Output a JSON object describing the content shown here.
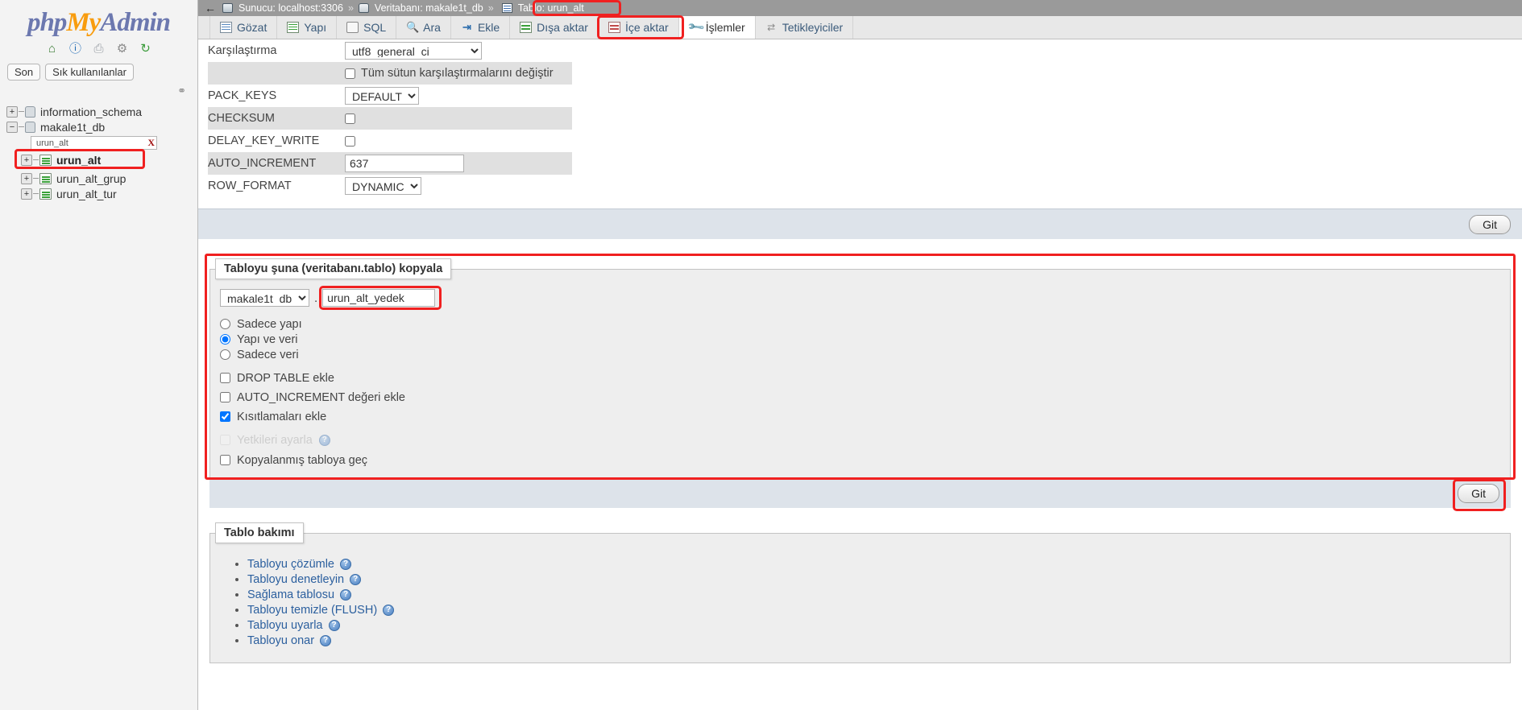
{
  "sidebar": {
    "logo": {
      "part1": "php",
      "part2": "My",
      "part3": "Admin"
    },
    "icons": [
      {
        "name": "home-icon",
        "glyph": "⌂"
      },
      {
        "name": "help-icon",
        "glyph": "?"
      },
      {
        "name": "documentation-icon",
        "glyph": "❐"
      },
      {
        "name": "settings-gear-icon",
        "glyph": "⚙"
      },
      {
        "name": "reload-icon",
        "glyph": "↻"
      }
    ],
    "pills": [
      {
        "label": "Son"
      },
      {
        "label": "Sık kullanılanlar"
      }
    ],
    "chain_icon": "⚭",
    "tree": [
      {
        "label": "information_schema",
        "type": "db",
        "expander": "+"
      },
      {
        "label": "makale1t_db",
        "type": "db",
        "expander": "−"
      }
    ],
    "filter": {
      "value": "urun_alt",
      "clear_label": "X"
    },
    "tables": [
      {
        "label": "urun_alt",
        "expander": "+",
        "selected": true
      },
      {
        "label": "urun_alt_grup",
        "expander": "+",
        "selected": false
      },
      {
        "label": "urun_alt_tur",
        "expander": "+",
        "selected": false
      }
    ]
  },
  "breadcrumb": {
    "back_arrow": "←",
    "server": "Sunucu: localhost:3306",
    "database": "Veritabanı: makale1t_db",
    "table": "Tablo: urun_alt",
    "sep": "»"
  },
  "tabs": [
    {
      "label": "Gözat",
      "icon": "browse-icon",
      "active": false
    },
    {
      "label": "Yapı",
      "icon": "structure-icon",
      "active": false
    },
    {
      "label": "SQL",
      "icon": "sql-icon",
      "active": false
    },
    {
      "label": "Ara",
      "icon": "search-icon",
      "active": false
    },
    {
      "label": "Ekle",
      "icon": "insert-icon",
      "active": false
    },
    {
      "label": "Dışa aktar",
      "icon": "export-icon",
      "active": false
    },
    {
      "label": "İçe aktar",
      "icon": "import-icon",
      "active": false
    },
    {
      "label": "İşlemler",
      "icon": "operations-wrench-icon",
      "active": true
    },
    {
      "label": "Tetikleyiciler",
      "icon": "triggers-icon",
      "active": false
    }
  ],
  "table_options": {
    "rows": [
      {
        "label": "Karşılaştırma",
        "control": "select",
        "value": "utf8_general_ci"
      },
      {
        "label": "",
        "control": "checkbox",
        "value": "Tüm sütun karşılaştırmalarını değiştir",
        "checked": false
      },
      {
        "label": "PACK_KEYS",
        "control": "select",
        "value": "DEFAULT"
      },
      {
        "label": "CHECKSUM",
        "control": "checkbox",
        "value": "",
        "checked": false
      },
      {
        "label": "DELAY_KEY_WRITE",
        "control": "checkbox",
        "value": "",
        "checked": false
      },
      {
        "label": "AUTO_INCREMENT",
        "control": "text",
        "value": "637"
      },
      {
        "label": "ROW_FORMAT",
        "control": "select",
        "value": "DYNAMIC"
      }
    ],
    "submit_label": "Git"
  },
  "copy_table": {
    "legend": "Tabloyu şuna (veritabanı.tablo) kopyala",
    "db_select": "makale1t_db",
    "dot": ".",
    "table_name": "urun_alt_yedek",
    "radios": [
      {
        "label": "Sadece yapı",
        "checked": false
      },
      {
        "label": "Yapı ve veri",
        "checked": true
      },
      {
        "label": "Sadece veri",
        "checked": false
      }
    ],
    "checkboxes": [
      {
        "label": "DROP TABLE ekle",
        "checked": false,
        "disabled": false,
        "help": false
      },
      {
        "label": "AUTO_INCREMENT değeri ekle",
        "checked": false,
        "disabled": false,
        "help": false
      },
      {
        "label": "Kısıtlamaları ekle",
        "checked": true,
        "disabled": false,
        "help": false
      }
    ],
    "checkboxes2": [
      {
        "label": "Yetkileri ayarla",
        "checked": false,
        "disabled": true,
        "help": true
      },
      {
        "label": "Kopyalanmış tabloya geç",
        "checked": false,
        "disabled": false,
        "help": false
      }
    ],
    "submit_label": "Git"
  },
  "maintenance": {
    "legend": "Tablo bakımı",
    "items": [
      {
        "label": "Tabloyu çözümle",
        "help": "?"
      },
      {
        "label": "Tabloyu denetleyin",
        "help": "?"
      },
      {
        "label": "Sağlama tablosu",
        "help": "?"
      },
      {
        "label": "Tabloyu temizle (FLUSH)",
        "help": "?"
      },
      {
        "label": "Tabloyu uyarla",
        "help": "?"
      },
      {
        "label": "Tabloyu onar",
        "help": "?"
      }
    ]
  },
  "colors": {
    "accent": "#6c78af",
    "brand_orange": "#f89c0e",
    "annotation_red": "#f02020",
    "link_blue": "#2b5f9e"
  }
}
